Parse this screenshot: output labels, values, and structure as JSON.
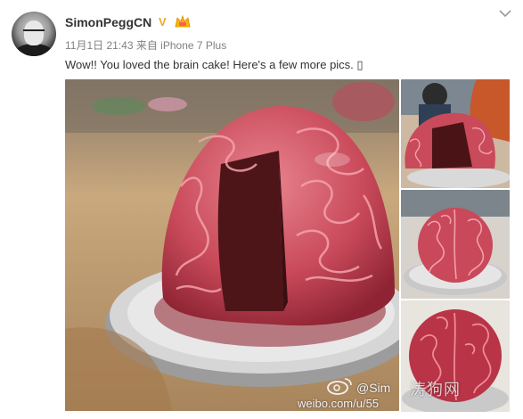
{
  "post": {
    "username": "SimonPeggCN",
    "verified_badge": "V",
    "timestamp": "11月1日 21:43",
    "source": "来自 iPhone 7 Plus",
    "text": "Wow!! You loved the brain cake! Here's a few more pics. ▯"
  },
  "media": {
    "images": [
      "brain-cake-sliced",
      "brain-cake-whole-party",
      "brain-cake-top-view",
      "brain-cake-close-up"
    ],
    "watermark_handle": "@Sim",
    "watermark_url": "weibo.com/u/55",
    "site_watermark": "涛狗网"
  },
  "icons": {
    "verified": "verified-v-icon",
    "member": "vip-member-icon",
    "menu": "chevron-down-icon",
    "weibo": "weibo-logo-icon"
  },
  "colors": {
    "verified": "#f5a623",
    "cake": "#c63f4f",
    "cake_inside": "#5a1a1c",
    "board": "#c9c9c9"
  }
}
